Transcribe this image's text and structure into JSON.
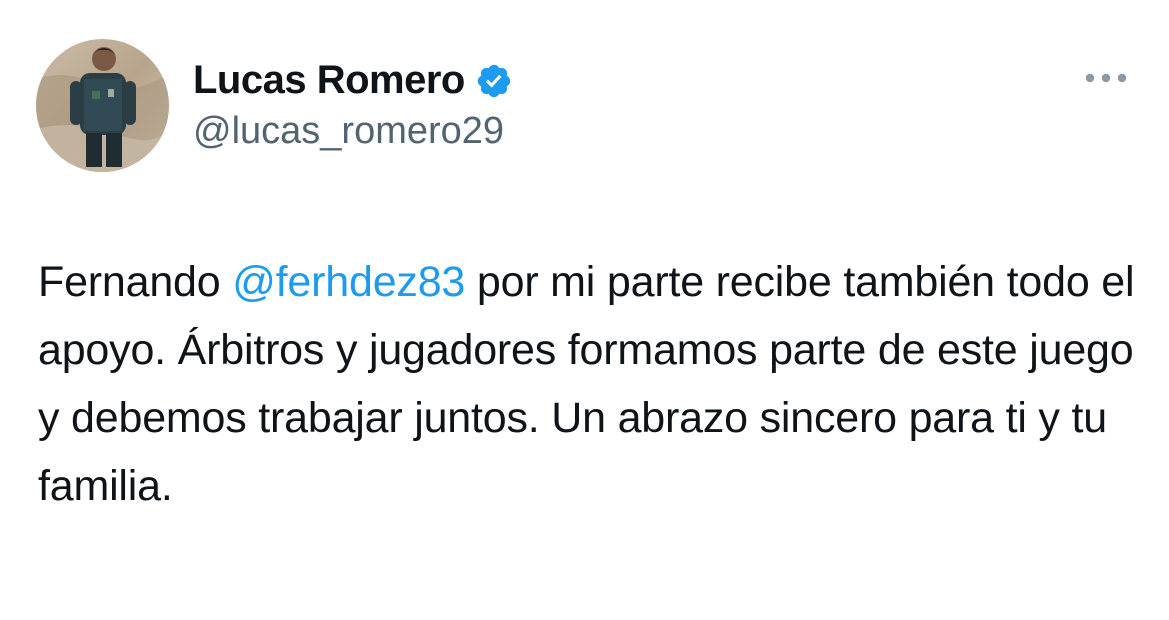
{
  "author": {
    "display_name": "Lucas Romero",
    "handle": "@lucas_romero29",
    "verified": true,
    "avatar_icon": "profile-photo-football-player"
  },
  "more_icon": "ellipsis-icon",
  "tweet": {
    "text_before_mention": "Fernando ",
    "mention": "@ferhdez83",
    "text_after_mention": " por mi parte recibe también todo el apoyo. Árbitros y jugadores formamos parte de este juego y debemos trabajar juntos. Un abrazo sincero para ti y tu familia."
  },
  "colors": {
    "accent": "#1d9bf0",
    "text": "#0f1419",
    "secondary_text": "#536471",
    "more_dots": "#8b98a5"
  }
}
